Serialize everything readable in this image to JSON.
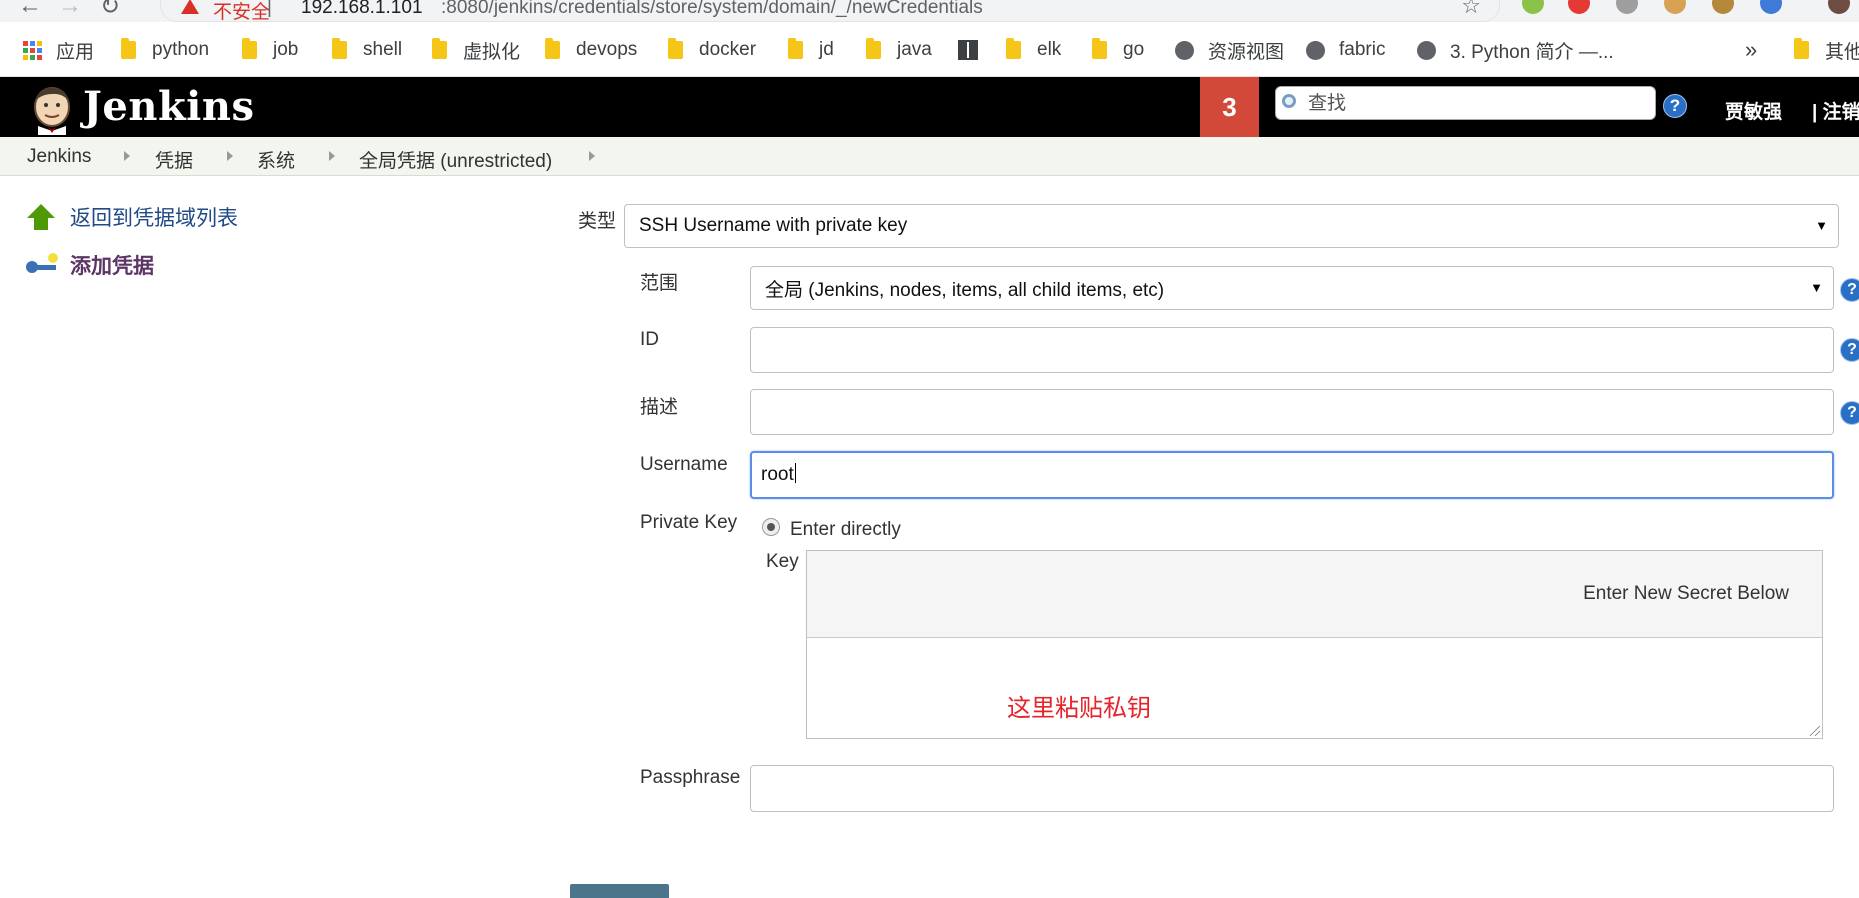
{
  "browser": {
    "security_label": "不安全",
    "url_separator": "|",
    "url_host": "192.168.1.101",
    "url_path": ":8080/jenkins/credentials/store/system/domain/_/newCredentials"
  },
  "bookmarks": {
    "items": [
      {
        "label": "应用",
        "icon": "apps-icon"
      },
      {
        "label": "python",
        "icon": "folder-icon"
      },
      {
        "label": "job",
        "icon": "folder-icon"
      },
      {
        "label": "shell",
        "icon": "folder-icon"
      },
      {
        "label": "虚拟化",
        "icon": "folder-icon"
      },
      {
        "label": "devops",
        "icon": "folder-icon"
      },
      {
        "label": "docker",
        "icon": "folder-icon"
      },
      {
        "label": "jd",
        "icon": "folder-icon"
      },
      {
        "label": "java",
        "icon": "folder-icon"
      },
      {
        "label": "",
        "icon": "book-icon"
      },
      {
        "label": "elk",
        "icon": "folder-icon"
      },
      {
        "label": "go",
        "icon": "folder-icon"
      },
      {
        "label": "资源视图",
        "icon": "globe-icon"
      },
      {
        "label": "fabric",
        "icon": "globe-icon"
      },
      {
        "label": "3. Python 简介 —...",
        "icon": "globe-icon"
      }
    ],
    "overflow": "»",
    "other_label": "其他"
  },
  "header": {
    "title": "Jenkins",
    "badge_count": "3",
    "search_placeholder": "查找",
    "help": "?",
    "user": "贾敏强",
    "logout": "| 注销"
  },
  "breadcrumb": [
    "Jenkins",
    "凭据",
    "系统",
    "全局凭据 (unrestricted)"
  ],
  "sidebar": {
    "back": "返回到凭据域列表",
    "add": "添加凭据"
  },
  "form": {
    "kind_label": "类型",
    "kind_value": "SSH Username with private key",
    "scope_label": "范围",
    "scope_value": "全局 (Jenkins, nodes, items, all child items, etc)",
    "id_label": "ID",
    "id_value": "",
    "desc_label": "描述",
    "desc_value": "",
    "username_label": "Username",
    "username_value": "root",
    "private_key_label": "Private Key",
    "enter_directly_label": "Enter directly",
    "key_label": "Key",
    "secret_title": "Enter New Secret Below",
    "secret_hint": "这里粘贴私钥",
    "passphrase_label": "Passphrase",
    "passphrase_value": ""
  },
  "colors": {
    "jenkins_header": "#000000",
    "badge": "#d24939",
    "link": "#204a87",
    "hint_red": "#e5242b"
  }
}
